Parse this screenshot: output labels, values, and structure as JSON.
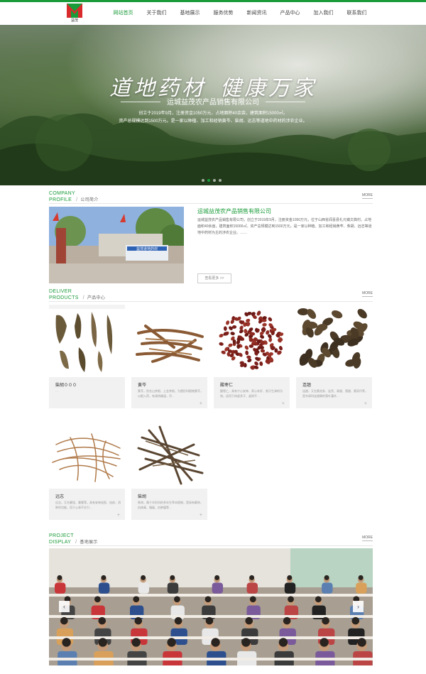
{
  "nav": {
    "logo_text": "益茂",
    "items": [
      {
        "label": "网站首页",
        "active": true
      },
      {
        "label": "关于我们",
        "active": false
      },
      {
        "label": "基地展示",
        "active": false
      },
      {
        "label": "服务优势",
        "active": false
      },
      {
        "label": "新闻资讯",
        "active": false
      },
      {
        "label": "产品中心",
        "active": false
      },
      {
        "label": "加入我们",
        "active": false
      },
      {
        "label": "联系我们",
        "active": false
      }
    ]
  },
  "hero": {
    "title_left": "道地药材",
    "title_right": "健康万家",
    "company": "运城益茂农产品销售有限公司",
    "desc_line1": "创立于2019年9月，注册资金1050万元，占地面积40余亩，建筑面积15000㎡。",
    "desc_line2": "资产总规模达到1500万元。是一家以种植、加工和经销黄芩、柴胡、远志等道地中药材的涉农企业。",
    "slides": 4,
    "active_slide": 1
  },
  "about": {
    "en_line1": "COMPANY",
    "en_line2": "PROFILE",
    "sep": "/",
    "cn": "公司简介",
    "more": "MORE",
    "title": "运城益茂农产品销售有限公司",
    "text": "运城益茂农产品销售有限公司，创立于2019年9月，注册资金1050万元，位于山西省闻喜县礼元镇文典村。占地面积40余亩，建筑面积15000㎡。资产总规模达到1500万元。是一家以种植、加工和经销黄芩、柴胡、远志等道地中药材为主的涉农企业。……",
    "button": "查看更多 >>",
    "gate_sign": "益茂道地药材"
  },
  "products": {
    "en_line1": "DELIVER",
    "en_line2": "PRODUCTS",
    "sep": "/",
    "cn": "产品中心",
    "more": "MORE",
    "items": [
      {
        "name": "柴胡０００",
        "desc": "…"
      },
      {
        "name": "黄芩",
        "desc": "黄芩，别名山茶根、土金茶根，为唇形科植物黄芩，以根入药，有清热燥湿，泻…"
      },
      {
        "name": "酸枣仁",
        "desc": "酸枣仁，具有宁心安神、养心补肝、敛汗生津的功效。适用于体虚多汗、虚烦不…"
      },
      {
        "name": "连翘",
        "desc": "连翘，又名黄花条、连壳、青翘、落翘、黄奇丹等，是木犀科连翘属的落叶灌木…"
      },
      {
        "name": "远志",
        "desc": "远志，又名葽绕、蕀蒬等。具有安神益智、祛痰、消肿的功能，用于心肾不交引…"
      },
      {
        "name": "柴胡",
        "desc": "柴胡，属于伞形科的多年生草本植物，是具有解热、抗病毒、镇痛、抗肿瘤等…"
      }
    ],
    "plus": "+"
  },
  "display": {
    "en_line1": "PROJECT",
    "en_line2": "DISPLAY",
    "sep": "/",
    "cn": "基地展示",
    "more": "MORE",
    "prev": "‹",
    "next": "›"
  },
  "colors": {
    "accent": "#1a9b39"
  }
}
